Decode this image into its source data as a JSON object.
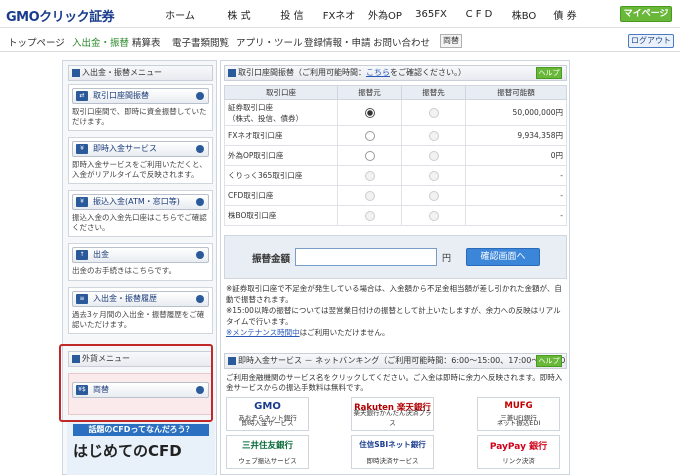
{
  "header": {
    "logo": "GMOクリック証券",
    "nav": [
      "ホーム",
      "株 式",
      "投 信",
      "FXネオ",
      "外為OP",
      "365FX",
      "C F D",
      "株BO",
      "債 券"
    ],
    "mypage": "マイページ"
  },
  "subnav": {
    "items": [
      "トップページ",
      "入出金・振替",
      "精算表",
      "電子書類閲覧",
      "アプリ・ツール",
      "登録情報・申請",
      "お問い合わせ"
    ],
    "settings": "両替",
    "logout": "ログアウト"
  },
  "left": {
    "menu_title": "入出金・振替メニュー",
    "items": [
      {
        "label": "取引口座間振替",
        "desc": "取引口座間で、即時に資金振替していただけます。"
      },
      {
        "label": "即時入金サービス",
        "desc": "即時入金サービスをご利用いただくと、入金がリアルタイムで反映されます。"
      },
      {
        "label": "振込入金(ATM・窓口等)",
        "desc": "振込入金の入金先口座はこちらでご確認ください。"
      },
      {
        "label": "出金",
        "desc": "出金のお手続きはこちらです。"
      },
      {
        "label": "入出金・振替履歴",
        "desc": "過去3ヶ月間の入出金・振替履歴をご確認いただけます。"
      }
    ],
    "fx_title": "外貨メニュー",
    "fx_item": "両替",
    "banner_line1": "話題のCFDってなんだろう？",
    "banner_line2": "はじめてのCFD"
  },
  "transfer": {
    "title": "取引口座間振替（ご利用可能時間：",
    "title_link": "こちら",
    "title_end": "をご確認ください。）",
    "help": "ヘルプ",
    "columns": [
      "取引口座",
      "振替元",
      "振替先",
      "振替可能額"
    ],
    "rows": [
      {
        "name": "証券取引口座\n（株式、投信、債券）",
        "amount": "50,000,000円",
        "from": "on",
        "to": "dis"
      },
      {
        "name": "FXネオ取引口座",
        "amount": "9,934,358円",
        "from": "off",
        "to": "dis"
      },
      {
        "name": "外為OP取引口座",
        "amount": "0円",
        "from": "off",
        "to": "dis"
      },
      {
        "name": "くりっく365取引口座",
        "amount": "-",
        "from": "dis",
        "to": "dis"
      },
      {
        "name": "CFD取引口座",
        "amount": "-",
        "from": "dis",
        "to": "dis"
      },
      {
        "name": "株BO取引口座",
        "amount": "-",
        "from": "dis",
        "to": "dis"
      }
    ],
    "amount_label": "振替金額",
    "amount_unit": "円",
    "amount_value": "",
    "confirm": "確認画面へ",
    "note1": "※証券取引口座で不足金が発生している場合は、入金額から不足金相当額が差し引かれた金額が、自動で振替されます。",
    "note2": "※15:00以降の振替については翌営業日付けの振替として計上いたしますが、余力への反映はリアルタイムで行います。",
    "note3_link": "※メンテナンス時間中",
    "note3_end": "はご利用いただけません。"
  },
  "instant": {
    "title": "即時入金サービス － ネットバンキング（ご利用可能時間：6:00～15:00、17:00～翌5:30）",
    "help": "ヘルプ",
    "desc": "ご利用金融機関のサービス名をクリックしてください。ご入金は即時に余力へ反映されます。即時入金サービスからの振込手数料は無料です。",
    "banks": [
      {
        "logo": "GMO",
        "sub": "あおぞらネット銀行",
        "cap": "即時入金サービス"
      },
      {
        "logo": "Rakuten 楽天銀行",
        "sub": "",
        "cap": "楽天銀行かんたん決済プラス"
      },
      {
        "logo": "MUFG",
        "sub": "三菱UFJ銀行",
        "cap": "ネット振込EDI"
      },
      {
        "logo": "三井住友銀行",
        "sub": "",
        "cap": "ウェブ振込サービス"
      },
      {
        "logo": "住信SBIネット銀行",
        "sub": "",
        "cap": "即時決済サービス"
      },
      {
        "logo": "PayPay 銀行",
        "sub": "",
        "cap": "リンク決済"
      }
    ]
  },
  "colors": {
    "brand": "#1a3c8c",
    "accent_green": "#6ab83a",
    "accent_blue": "#3b86d8",
    "highlight_red": "#c0282a"
  }
}
